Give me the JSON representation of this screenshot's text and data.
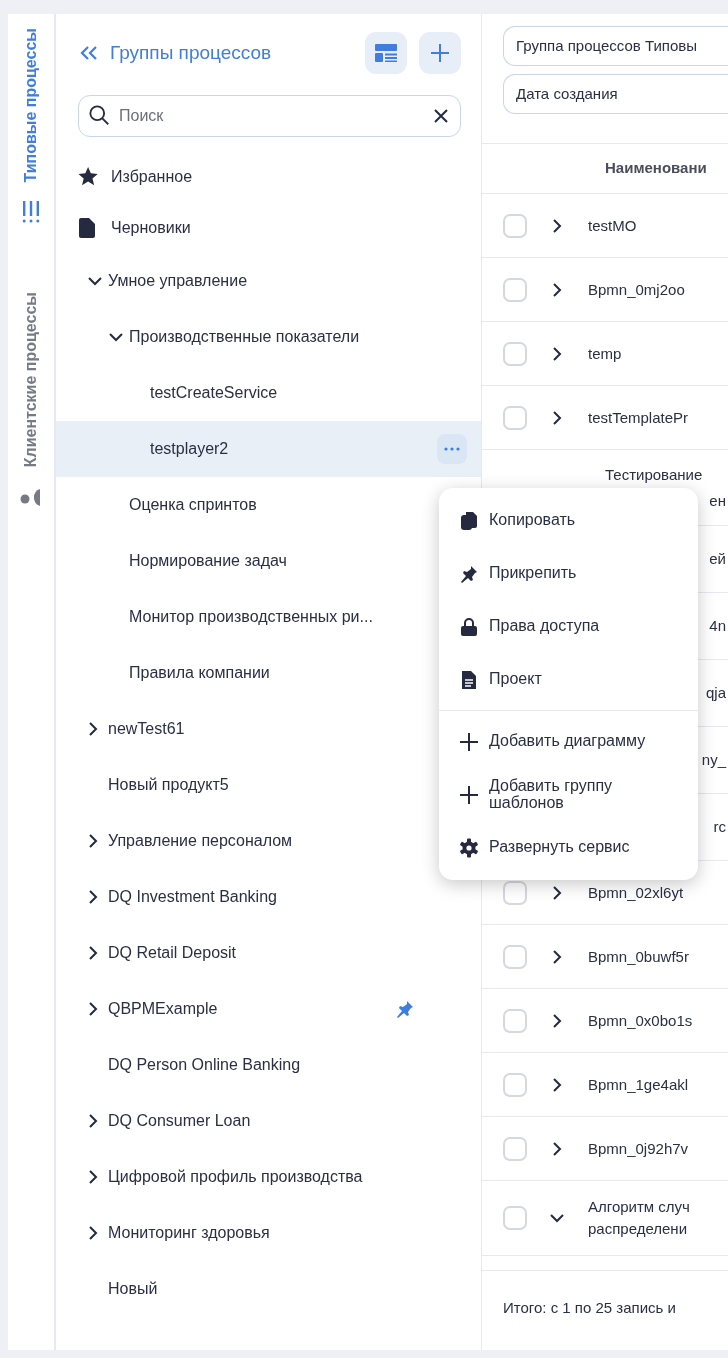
{
  "rail": {
    "tabs": [
      {
        "label": "Типовые процессы",
        "selected": true
      },
      {
        "label": "Клиентские процессы",
        "selected": false
      }
    ]
  },
  "sidebar": {
    "title": "Группы процессов",
    "search": {
      "placeholder": "Поиск"
    },
    "special": [
      {
        "label": "Избранное"
      },
      {
        "label": "Черновики"
      }
    ],
    "tree": [
      {
        "label": "Умное управление",
        "expanded": true,
        "children": [
          {
            "label": "Производственные показатели",
            "expanded": true,
            "children": [
              {
                "label": "testCreateService",
                "selected": false
              },
              {
                "label": "testplayer2",
                "selected": true
              }
            ]
          },
          {
            "label": "Оценка спринтов",
            "selected": false
          },
          {
            "label": "Нормирование задач",
            "selected": false
          },
          {
            "label": "Монитор производственных ри...",
            "selected": false
          },
          {
            "label": "Правила компании",
            "selected": false
          }
        ]
      },
      {
        "label": "newTest61",
        "expanded": false,
        "selected": false
      },
      {
        "label": "Новый продукт5",
        "selected": false
      },
      {
        "label": "Управление персоналом",
        "expanded": false,
        "selected": false
      },
      {
        "label": "DQ Investment Banking",
        "expanded": false,
        "selected": false
      },
      {
        "label": "DQ Retail Deposit",
        "expanded": false,
        "selected": false
      },
      {
        "label": "QBPMExample",
        "expanded": false,
        "selected": false,
        "pinned": true
      },
      {
        "label": "DQ Person Online Banking",
        "selected": false
      },
      {
        "label": "DQ Consumer Loan",
        "expanded": false,
        "selected": false
      },
      {
        "label": "Цифровой профиль производства",
        "expanded": false,
        "selected": false
      },
      {
        "label": "Мониторинг здоровья",
        "expanded": false,
        "selected": false
      },
      {
        "label": "Новый",
        "selected": false
      }
    ]
  },
  "context_menu": {
    "sections": [
      [
        {
          "label": "Копировать"
        },
        {
          "label": "Прикрепить"
        },
        {
          "label": "Права доступа"
        },
        {
          "label": "Проект"
        }
      ],
      [
        {
          "label": "Добавить диаграмму"
        },
        {
          "label": "Добавить группу шаблонов"
        },
        {
          "label": "Развернуть сервис"
        }
      ]
    ]
  },
  "filters": [
    {
      "value": "Группа процессов Типовы"
    },
    {
      "value": "Дата создания"
    }
  ],
  "table": {
    "columns": [
      "Наименовани"
    ],
    "rows": [
      {
        "kind": "full",
        "name": "testMO",
        "checked": false,
        "expanded": false
      },
      {
        "kind": "full",
        "name": "Bpmn_0mj2oo",
        "checked": false,
        "expanded": false
      },
      {
        "kind": "full",
        "name": "temp",
        "checked": false,
        "expanded": false
      },
      {
        "kind": "full",
        "name": "testTemplatePr",
        "checked": false,
        "expanded": false
      },
      {
        "kind": "top",
        "name": "Тестирование",
        "fragment": "ен"
      },
      {
        "kind": "covered",
        "fragment": "ей"
      },
      {
        "kind": "covered",
        "fragment": "4n"
      },
      {
        "kind": "covered",
        "fragment": "qja"
      },
      {
        "kind": "covered",
        "fragment": "ny_"
      },
      {
        "kind": "covered",
        "fragment": "rc"
      },
      {
        "kind": "full",
        "name": "Bpmn_02xl6yt",
        "checked": false,
        "expanded": false
      },
      {
        "kind": "full",
        "name": "Bpmn_0buwf5r",
        "checked": false,
        "expanded": false
      },
      {
        "kind": "full",
        "name": "Bpmn_0x0bo1s",
        "checked": false,
        "expanded": false
      },
      {
        "kind": "full",
        "name": "Bpmn_1ge4akl",
        "checked": false,
        "expanded": false
      },
      {
        "kind": "full",
        "name": "Bpmn_0j92h7v",
        "checked": false,
        "expanded": false
      },
      {
        "kind": "full",
        "name": "Алгоритм случ\nраспределени",
        "checked": false,
        "expanded": true
      }
    ]
  },
  "status_bar": {
    "text": "Итого: с 1 по 25 запись и"
  }
}
